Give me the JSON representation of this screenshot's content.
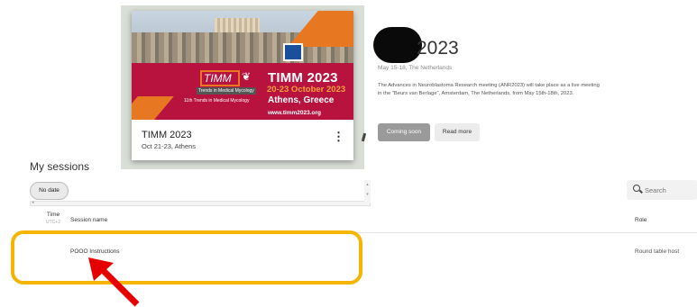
{
  "event_card": {
    "banner": {
      "logo_text": "TIMM",
      "logo_subtext": "Trends in Medical Mycology",
      "edition_text": "11th Trends in Medical Mycology",
      "title": "TIMM 2023",
      "dates": "20-23 October 2023",
      "location": "Athens, Greece",
      "url": "www.timm2023.org"
    },
    "title": "TIMM 2023",
    "subtitle": "Oct 21-23, Athens",
    "menu_icon": "kebab-menu-icon"
  },
  "event_info": {
    "title": "2023",
    "dates": "May 15-18, The Netherlands",
    "description": "The Advances in Neuroblastoma Research meeting (ANR2023) will take place as a live meeting in the \"Beurs van Berlage\", Amsterdam, The Netherlands, from May 15th-18th, 2023.",
    "coming_soon_label": "Coming soon",
    "read_more_label": "Read more"
  },
  "sessions": {
    "heading": "My sessions",
    "filter_chip": "No date",
    "search_placeholder": "Search",
    "columns": {
      "time": "Time",
      "time_zone": "UTC+2",
      "session_name": "Session name",
      "role": "Role"
    },
    "rows": [
      {
        "session_name": "POOO Instructions",
        "role": "Round table host"
      }
    ]
  },
  "annotations": {
    "highlight_color": "#f5b400",
    "arrow_color": "#e60000"
  }
}
